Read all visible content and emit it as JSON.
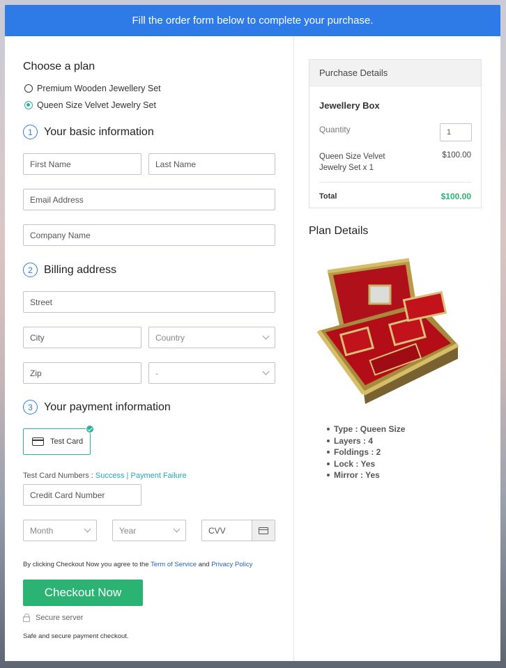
{
  "banner": {
    "text": "Fill the order form below to complete your purchase."
  },
  "plan": {
    "heading": "Choose a plan",
    "options": [
      {
        "label": "Premium Wooden Jewellery Set",
        "selected": false
      },
      {
        "label": "Queen Size Velvet Jewelry Set",
        "selected": true
      }
    ]
  },
  "basic": {
    "num": "1",
    "heading": "Your basic information",
    "first_name": "First Name",
    "last_name": "Last Name",
    "email": "Email Address",
    "company": "Company Name"
  },
  "billing": {
    "num": "2",
    "heading": "Billing address",
    "street": "Street",
    "city": "City",
    "country": "Country",
    "zip": "Zip",
    "state": "-"
  },
  "payment": {
    "num": "3",
    "heading": "Your payment information",
    "test_card": "Test Card",
    "test_numbers_label": "Test Card Numbers : ",
    "success": "Success",
    "separator": " | ",
    "failure": "Payment Failure",
    "card_number": "Credit Card Number",
    "month": "Month",
    "year": "Year",
    "cvv": "CVV"
  },
  "terms": {
    "prefix": "By clicking Checkout Now you agree to the ",
    "tos": "Term of Service",
    "and": " and ",
    "privacy": "Privacy Policy"
  },
  "checkout": {
    "label": "Checkout Now"
  },
  "secure": {
    "label": "Secure server",
    "note": "Safe and secure payment checkout."
  },
  "purchase": {
    "heading": "Purchase Details",
    "product": "Jewellery Box",
    "quantity_label": "Quantity",
    "quantity": "1",
    "item": "Queen Size Velvet Jewelry Set x 1",
    "item_price": "$100.00",
    "total_label": "Total",
    "total": "$100.00"
  },
  "plan_details": {
    "heading": "Plan Details",
    "features": [
      "Type : Queen Size",
      "Layers : 4",
      "Foldings : 2",
      "Lock : Yes",
      "Mirror : Yes"
    ]
  },
  "colors": {
    "accent": "#2e7be7",
    "teal": "#2bb39a",
    "green": "#2bb374",
    "link": "#26a4b8"
  }
}
